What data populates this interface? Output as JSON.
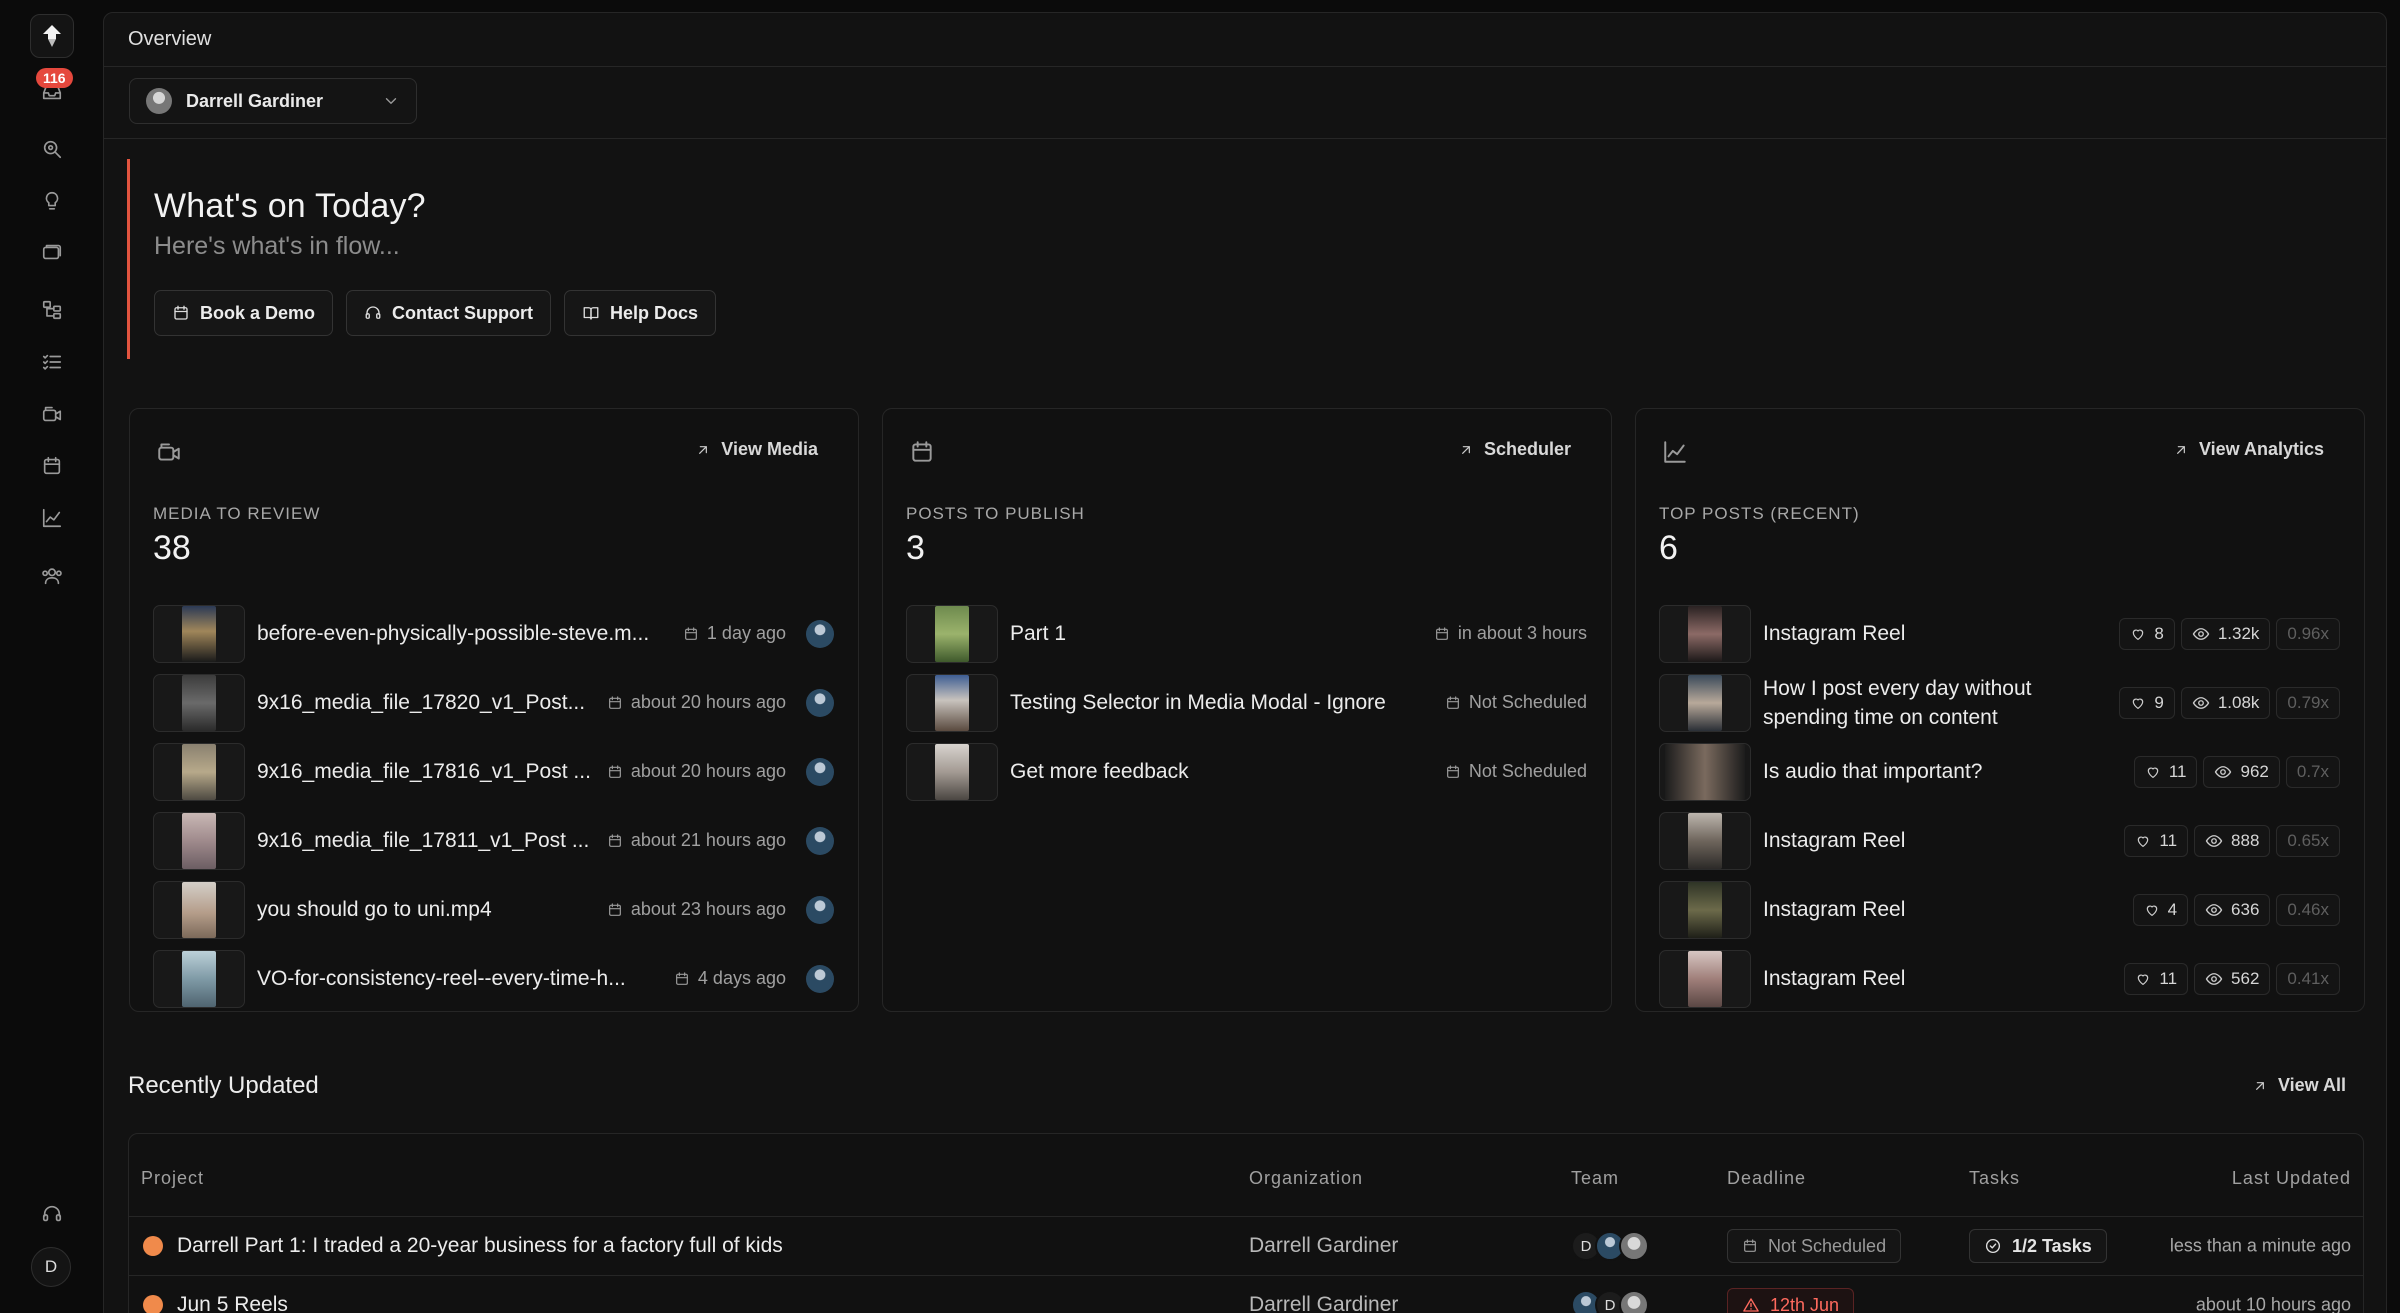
{
  "sidebar": {
    "notification_badge": "116",
    "user_initial": "D",
    "icons": [
      "inbox-icon",
      "search-icon",
      "lightbulb-icon",
      "folders-icon",
      "workflow-icon",
      "checklist-icon",
      "media-icon",
      "calendar-icon",
      "analytics-icon",
      "team-icon",
      "support-icon"
    ]
  },
  "header": {
    "title": "Overview"
  },
  "account_selector": {
    "name": "Darrell Gardiner"
  },
  "hero": {
    "title": "What's on Today?",
    "subtitle": "Here's what's in flow...",
    "buttons": [
      "Book a Demo",
      "Contact Support",
      "Help Docs"
    ],
    "accent_color": "#e2543f"
  },
  "media_card": {
    "link": "View Media",
    "label": "MEDIA TO REVIEW",
    "count": "38",
    "items": [
      {
        "title": "before-even-physically-possible-steve.m...",
        "time": "1 day ago"
      },
      {
        "title": "9x16_media_file_17820_v1_Post...",
        "time": "about 20 hours ago"
      },
      {
        "title": "9x16_media_file_17816_v1_Post ...",
        "time": "about 20 hours ago"
      },
      {
        "title": "9x16_media_file_17811_v1_Post ...",
        "time": "about 21 hours ago"
      },
      {
        "title": "you should go to uni.mp4",
        "time": "about 23 hours ago"
      },
      {
        "title": "VO-for-consistency-reel--every-time-h...",
        "time": "4 days ago"
      }
    ]
  },
  "posts_card": {
    "link": "Scheduler",
    "label": "POSTS TO PUBLISH",
    "count": "3",
    "items": [
      {
        "title": "Part 1",
        "time": "in about 3 hours"
      },
      {
        "title": "Testing Selector in Media Modal - Ignore",
        "time": "Not Scheduled"
      },
      {
        "title": "Get more feedback",
        "time": "Not Scheduled"
      }
    ]
  },
  "top_posts_card": {
    "link": "View Analytics",
    "label": "TOP POSTS (RECENT)",
    "count": "6",
    "items": [
      {
        "title": "Instagram Reel",
        "likes": "8",
        "views": "1.32k",
        "mult": "0.96x"
      },
      {
        "title": "How I post every day without spending time on content",
        "likes": "9",
        "views": "1.08k",
        "mult": "0.79x"
      },
      {
        "title": "Is audio that important?",
        "likes": "11",
        "views": "962",
        "mult": "0.7x"
      },
      {
        "title": "Instagram Reel",
        "likes": "11",
        "views": "888",
        "mult": "0.65x"
      },
      {
        "title": "Instagram Reel",
        "likes": "4",
        "views": "636",
        "mult": "0.46x"
      },
      {
        "title": "Instagram Reel",
        "likes": "11",
        "views": "562",
        "mult": "0.41x"
      }
    ]
  },
  "recently_updated": {
    "title": "Recently Updated",
    "link": "View All",
    "columns": [
      "Project",
      "Organization",
      "Team",
      "Deadline",
      "Tasks",
      "Last Updated"
    ],
    "rows": [
      {
        "project": "Darrell Part 1: I traded a 20-year business for a factory full of kids",
        "organization": "Darrell Gardiner",
        "team_initial": "D",
        "deadline": "Not Scheduled",
        "tasks": "1/2 Tasks",
        "updated": "less than a minute ago"
      },
      {
        "project": "Jun 5 Reels",
        "organization": "Darrell Gardiner",
        "team_initial": "D",
        "deadline": "12th Jun",
        "tasks": "",
        "updated": "about 10 hours ago"
      }
    ]
  }
}
